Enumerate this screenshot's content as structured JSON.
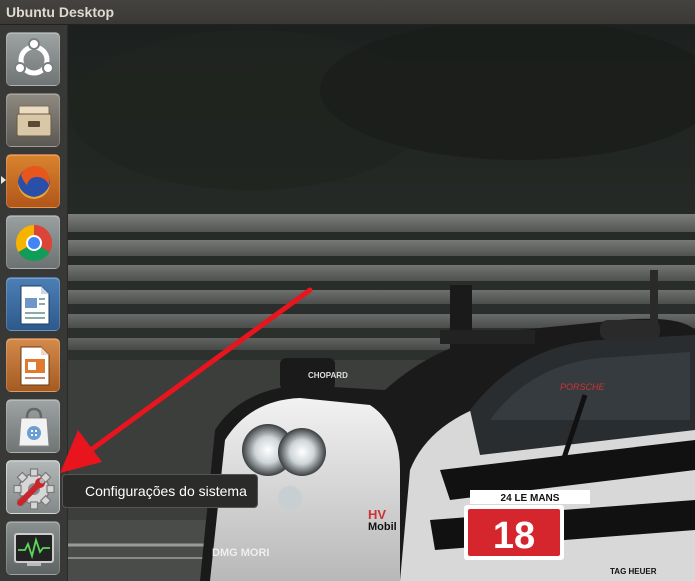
{
  "topbar": {
    "title": "Ubuntu Desktop"
  },
  "launcher": {
    "items": [
      {
        "name": "dash-home",
        "icon": "ubuntu-logo-icon"
      },
      {
        "name": "files",
        "icon": "file-cabinet-icon"
      },
      {
        "name": "firefox",
        "icon": "firefox-icon",
        "running": true
      },
      {
        "name": "chrome",
        "icon": "chrome-icon"
      },
      {
        "name": "libreoffice-writer",
        "icon": "writer-document-icon"
      },
      {
        "name": "libreoffice-impress",
        "icon": "impress-presentation-icon"
      },
      {
        "name": "software-center",
        "icon": "shopping-bag-icon"
      },
      {
        "name": "system-settings",
        "icon": "gear-wrench-icon",
        "hovered": true
      },
      {
        "name": "system-monitor",
        "icon": "monitor-pulse-icon"
      }
    ]
  },
  "tooltip": {
    "label": "Configurações do sistema"
  },
  "annotation": {
    "icon": "red-arrow-icon",
    "color": "#e8141e"
  },
  "wallpaper": {
    "car_number": "18",
    "text_chopard": "CHOPARD",
    "text_porsche": "PORSCHE",
    "text_lemans": "24 LE MANS",
    "text_mobil": "Mobil",
    "text_hv": "HV",
    "text_tagheuer": "TAG HEUER",
    "text_mori": "DMG MORI"
  }
}
